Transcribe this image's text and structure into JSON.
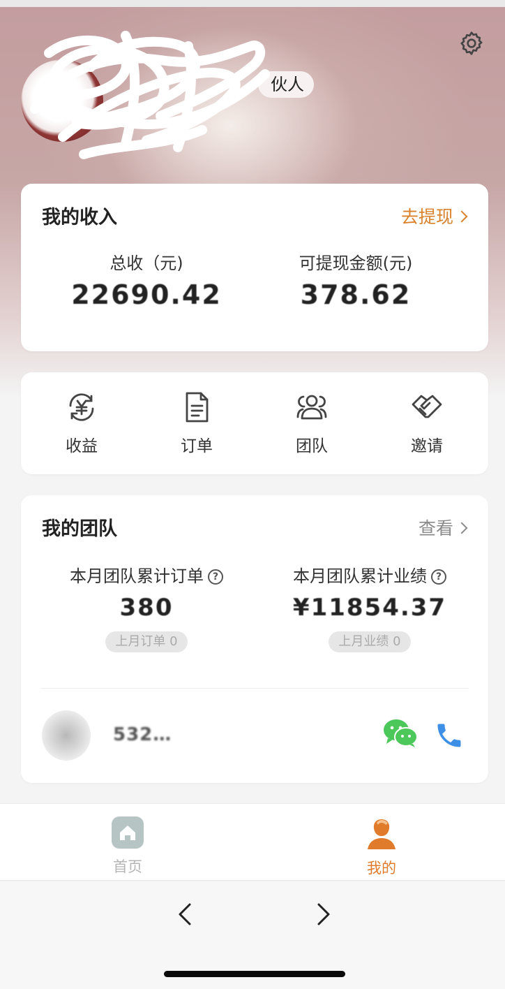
{
  "header": {
    "profile_tag": "伙人",
    "avatar_name": "",
    "profile_id": ""
  },
  "icons": {
    "settings": "gear-icon"
  },
  "income": {
    "title": "我的收入",
    "withdraw_link": "去提现",
    "total_label": "总收（元)",
    "total_value": "22690.42",
    "available_label": "可提现金额(元)",
    "available_value": "378.62"
  },
  "menu": {
    "items": [
      {
        "label": "收益",
        "icon": "yuan-exchange-icon"
      },
      {
        "label": "订单",
        "icon": "document-icon"
      },
      {
        "label": "团队",
        "icon": "people-icon"
      },
      {
        "label": "邀请",
        "icon": "handshake-icon"
      }
    ]
  },
  "team": {
    "title": "我的团队",
    "view_link": "查看",
    "orders_label": "本月团队累计订单",
    "orders_value": "380",
    "orders_last_month": "上月订单 0",
    "performance_label": "本月团队累计业绩",
    "performance_value": "¥11854.37",
    "performance_last_month": "上月业绩 0",
    "help_glyph": "?",
    "member_name": "532…"
  },
  "tabbar": {
    "tabs": [
      {
        "label": "首页",
        "icon": "home-icon",
        "active": false
      },
      {
        "label": "我的",
        "icon": "profile-icon",
        "active": true
      }
    ]
  },
  "colors": {
    "accent": "#e07b2c",
    "link_orange": "#d9822b",
    "wechat_green": "#4cc75a",
    "phone_blue": "#3e8fe6",
    "inactive": "#b5b5b5"
  }
}
